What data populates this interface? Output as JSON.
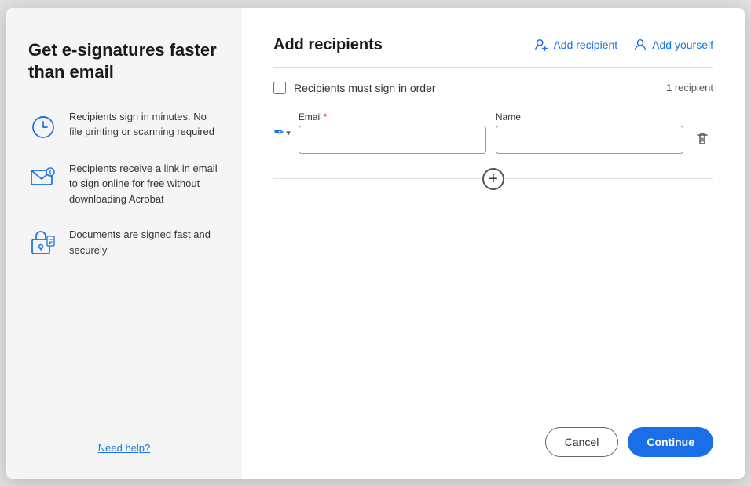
{
  "left": {
    "title": "Get e-signatures faster than email",
    "features": [
      {
        "id": "speed",
        "text": "Recipients sign in minutes. No file printing or scanning required"
      },
      {
        "id": "email",
        "text": "Recipients receive a link in email to sign online for free without downloading Acrobat"
      },
      {
        "id": "secure",
        "text": "Documents are signed fast and securely"
      }
    ],
    "need_help_label": "Need help?"
  },
  "right": {
    "title": "Add recipients",
    "add_recipient_label": "Add recipient",
    "add_yourself_label": "Add yourself",
    "sign_in_order_label": "Recipients must sign in order",
    "recipient_count": "1 recipient",
    "email_label": "Email",
    "name_label": "Name",
    "email_placeholder": "",
    "name_placeholder": ""
  },
  "footer": {
    "cancel_label": "Cancel",
    "continue_label": "Continue"
  }
}
